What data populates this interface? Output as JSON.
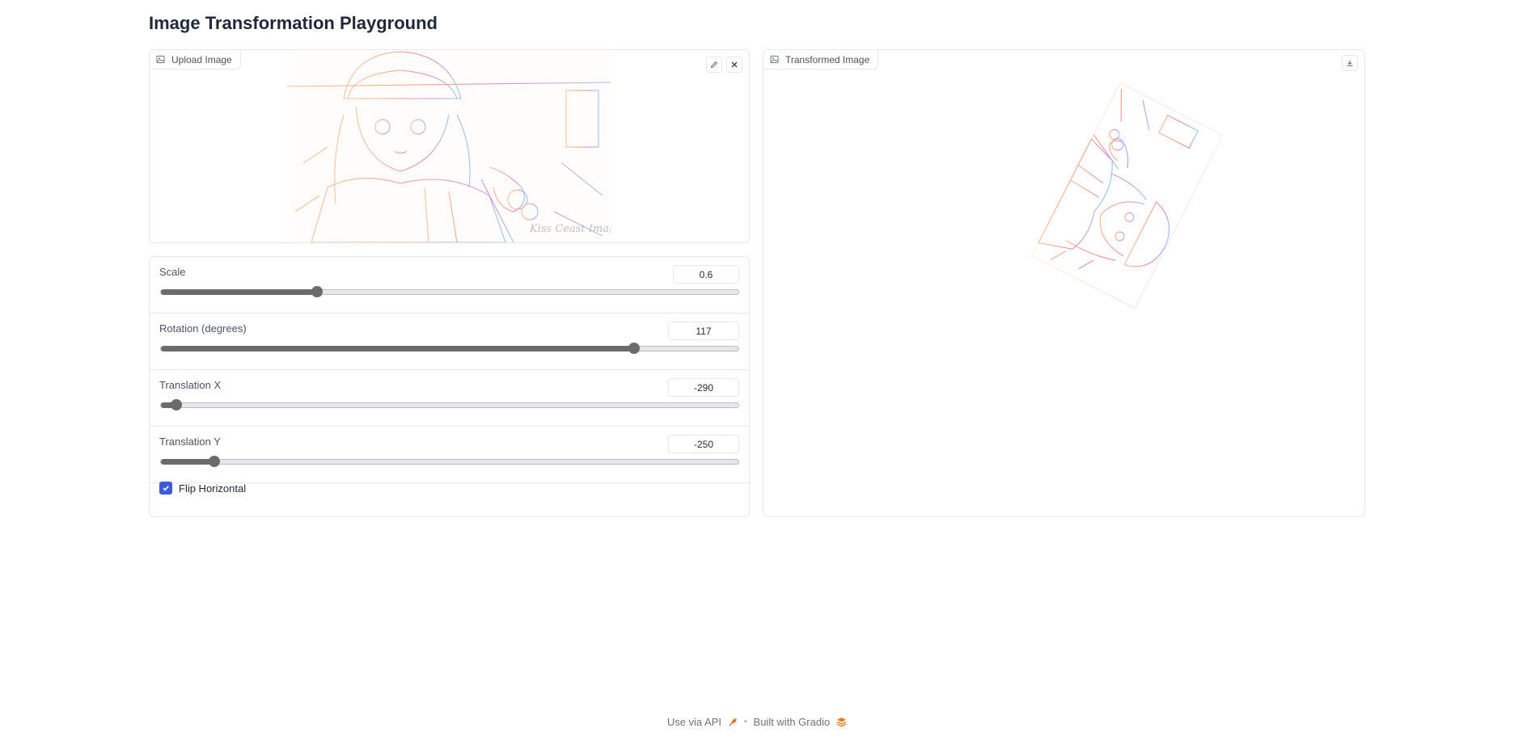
{
  "page": {
    "title": "Image Transformation Playground"
  },
  "input_panel": {
    "label": "Upload Image",
    "label_icon": "image-icon",
    "actions": [
      "edit-icon",
      "close-icon"
    ],
    "watermark": "Kiss Ceast Image"
  },
  "output_panel": {
    "label": "Transformed Image",
    "label_icon": "image-icon",
    "actions": [
      "download-icon"
    ]
  },
  "controls": {
    "scale": {
      "label": "Scale",
      "value": "0.6",
      "fraction": 0.27
    },
    "rotation": {
      "label": "Rotation (degrees)",
      "value": "117",
      "fraction": 0.82
    },
    "translation_x": {
      "label": "Translation X",
      "value": "-290",
      "fraction": 0.027
    },
    "translation_y": {
      "label": "Translation Y",
      "value": "-250",
      "fraction": 0.092
    },
    "flip_horizontal": {
      "label": "Flip Horizontal",
      "checked": true
    }
  },
  "colors": {
    "accent": "#3b5bdb",
    "slider": "#6b6b6b",
    "border": "#e5e7eb",
    "sketch_warm": "#f0a070",
    "sketch_pink": "#d060d0",
    "sketch_blue": "#60a0e0"
  },
  "footer": {
    "api_link": "Use via API",
    "built_with": "Built with Gradio"
  }
}
